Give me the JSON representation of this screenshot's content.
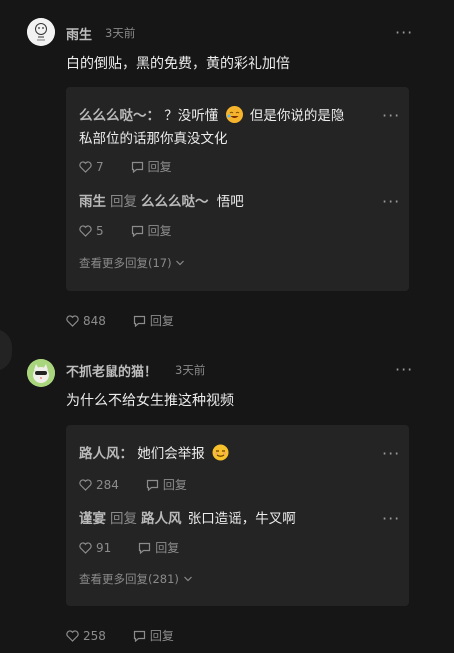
{
  "comments": [
    {
      "author": "雨生",
      "time": "3天前",
      "text": "白的倒贴，黑的免费，黄的彩礼加倍",
      "likes": "848",
      "reply_label": "回复",
      "replies": [
        {
          "author": "么么么哒～：",
          "text_a": "？没听懂",
          "emoji": "laughing-tears-emoji",
          "text_b": "但是你说的是隐",
          "text_c": "私部位的话那你真没文化",
          "likes": "7",
          "reply_label": "回复"
        },
        {
          "author": "雨生",
          "reply_word": "回复",
          "target": "么么么哒～",
          "text": "悟吧",
          "likes": "5",
          "reply_label": "回复"
        }
      ],
      "see_more": "查看更多回复(17)"
    },
    {
      "author": "不抓老鼠的猫！",
      "time": "3天前",
      "text": "为什么不给女生推这种视频",
      "likes": "258",
      "reply_label": "回复",
      "replies": [
        {
          "author": "路人风：",
          "text": "她们会举报",
          "emoji": "smirk-emoji",
          "likes": "284",
          "reply_label": "回复"
        },
        {
          "author": "谨宴",
          "reply_word": "回复",
          "target": "路人风",
          "text": "张口造谣，牛叉啊",
          "likes": "91",
          "reply_label": "回复"
        }
      ],
      "see_more": "查看更多回复(281)"
    }
  ],
  "icons": {
    "more": "more-dots-icon",
    "like": "heart-icon",
    "reply": "reply-icon",
    "expand": "chevron-down-icon"
  },
  "colors": {
    "background": "#161616",
    "card": "#242424",
    "text": "#ececec",
    "muted": "#8a8a8a"
  }
}
